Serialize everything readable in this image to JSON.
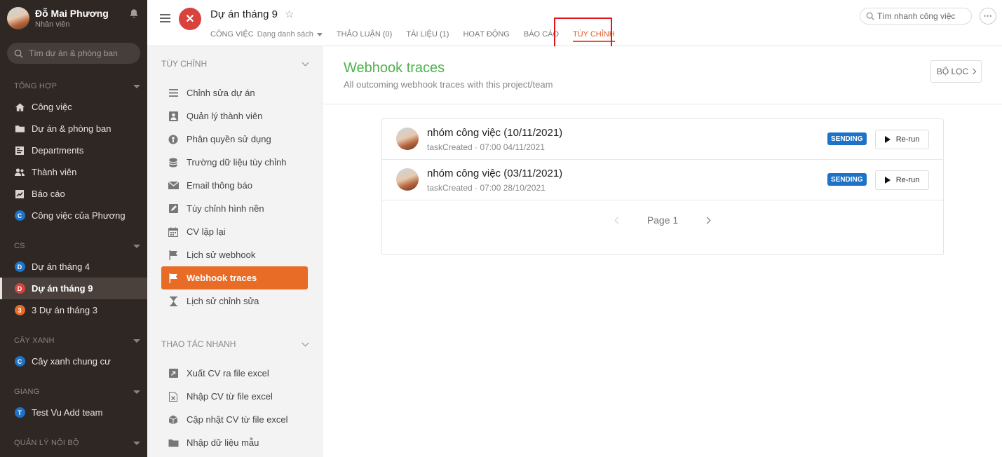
{
  "user": {
    "name": "Đỗ Mai Phương",
    "role": "Nhân viên"
  },
  "sidebar": {
    "search_placeholder": "Tìm dự án & phòng ban",
    "sections": [
      {
        "header": "TỔNG HỢP",
        "items": [
          {
            "label": "Công việc",
            "icon": "home-icon"
          },
          {
            "label": "Dự án & phòng ban",
            "icon": "folder-icon"
          },
          {
            "label": "Departments",
            "icon": "departments-icon"
          },
          {
            "label": "Thành viên",
            "icon": "users-icon"
          },
          {
            "label": "Báo cáo",
            "icon": "chart-icon"
          },
          {
            "label": "Công việc của Phương",
            "icon": "dot",
            "letter": "C",
            "color": "#1e73c8"
          }
        ]
      },
      {
        "header": "CS",
        "items": [
          {
            "label": "Dự án tháng 4",
            "letter": "D",
            "color": "#1e73c8"
          },
          {
            "label": "Dự án tháng 9",
            "letter": "D",
            "color": "#d9433d",
            "active": true
          },
          {
            "label": "3 Dự án tháng 3",
            "letter": "3",
            "color": "#e86b26"
          }
        ]
      },
      {
        "header": "CÂY XANH",
        "items": [
          {
            "label": "Cây xanh chung cư",
            "letter": "C",
            "color": "#1e73c8"
          }
        ]
      },
      {
        "header": "GIANG",
        "items": [
          {
            "label": "Test Vu Add team",
            "letter": "T",
            "color": "#1e73c8"
          }
        ]
      },
      {
        "header": "QUẢN LÝ NỘI BỘ",
        "items": []
      }
    ]
  },
  "project": {
    "title": "Dự án tháng 9",
    "tabs": [
      {
        "label": "CÔNG VIỆC",
        "sub": "Dạng danh sách"
      },
      {
        "label": "THẢO LUẬN (0)"
      },
      {
        "label": "TÀI LIỆU (1)"
      },
      {
        "label": "HOẠT ĐỘNG"
      },
      {
        "label": "BÁO CÁO"
      },
      {
        "label": "TÙY CHỈNH",
        "active": true
      }
    ],
    "search_placeholder": "Tìm nhanh công việc"
  },
  "customize": {
    "header": "TÙY CHỈNH",
    "items": [
      "Chỉnh sửa dự án",
      "Quản lý thành viên",
      "Phân quyền sử dụng",
      "Trường dữ liệu tùy chỉnh",
      "Email thông báo",
      "Tùy chỉnh hình nền",
      "CV lặp lại",
      "Lịch sử webhook",
      "Webhook traces",
      "Lịch sử chỉnh sửa"
    ],
    "active_index": 8,
    "quick_header": "THAO TÁC NHANH",
    "quick_items": [
      "Xuất CV ra file excel",
      "Nhập CV từ file excel",
      "Cập nhật CV từ file excel",
      "Nhập dữ liệu mẫu"
    ]
  },
  "main": {
    "title": "Webhook traces",
    "subtitle": "All outcoming webhook traces with this project/team",
    "filter_label": "BỘ LỌC",
    "traces": [
      {
        "title": "nhóm công việc (10/11/2021)",
        "meta": "taskCreated · 07:00 04/11/2021",
        "status": "SENDING",
        "action": "Re-run"
      },
      {
        "title": "nhóm công việc (03/11/2021)",
        "meta": "taskCreated · 07:00 28/10/2021",
        "status": "SENDING",
        "action": "Re-run"
      }
    ],
    "page_label": "Page 1"
  },
  "colors": {
    "accent": "#e86b26",
    "title_green": "#4db14a",
    "badge_blue": "#1e73c8",
    "sidebar_bg": "#2f2724"
  }
}
